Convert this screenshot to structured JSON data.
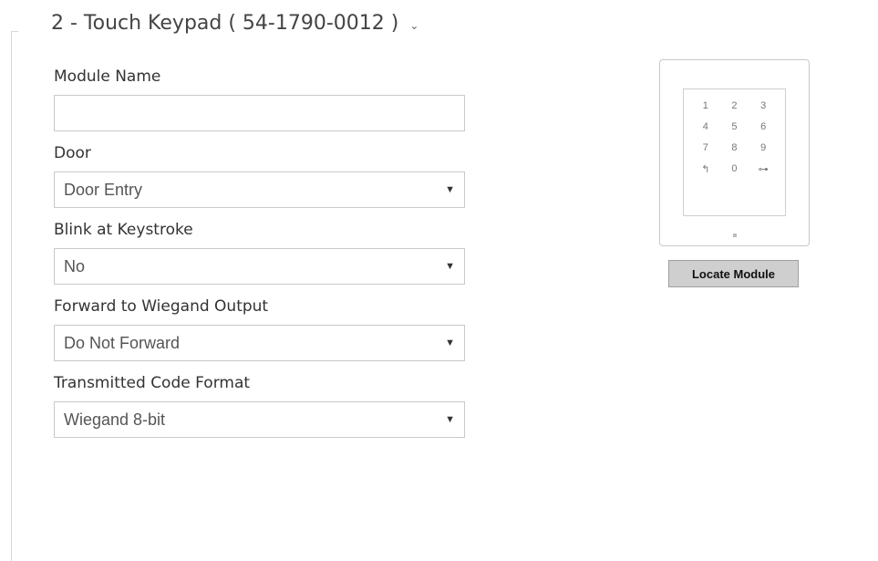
{
  "module": {
    "title": "2 - Touch Keypad ( 54-1790-0012 )",
    "collapse_icon": "chevron-down-icon"
  },
  "form": {
    "module_name": {
      "label": "Module Name",
      "value": ""
    },
    "door": {
      "label": "Door",
      "value": "Door Entry"
    },
    "blink": {
      "label": "Blink at Keystroke",
      "value": "No"
    },
    "wiegand": {
      "label": "Forward to Wiegand Output",
      "value": "Do Not Forward"
    },
    "code_format": {
      "label": "Transmitted Code Format",
      "value": "Wiegand 8-bit"
    }
  },
  "device": {
    "keys": [
      "1",
      "2",
      "3",
      "4",
      "5",
      "6",
      "7",
      "8",
      "9",
      "↰",
      "0",
      "⊶"
    ],
    "locate_label": "Locate Module"
  }
}
